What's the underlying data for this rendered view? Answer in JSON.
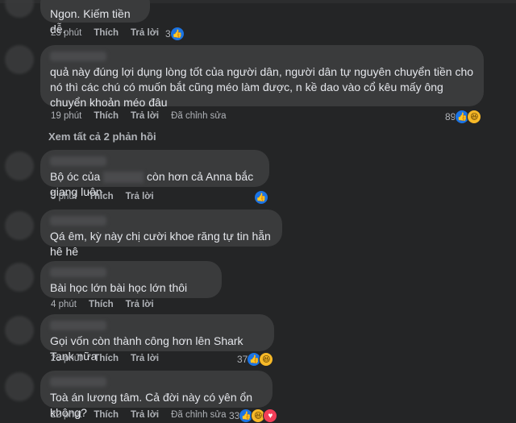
{
  "comments": [
    {
      "text": "Ngon. Kiếm tiền dễ.",
      "time": "23 phút",
      "like": "Thích",
      "reply": "Trả lời",
      "reaction_count": "3"
    },
    {
      "text": "quả này đúng lợi dụng lòng tốt của người dân, người dân tự nguyên chuyển tiền cho nó thì các chú có muốn bắt cũng méo làm được, n kề dao vào cổ kêu mấy ông chuyển khoản méo đâu",
      "time": "19 phút",
      "like": "Thích",
      "reply": "Trả lời",
      "edited": "Đã chỉnh sửa",
      "reaction_count": "89"
    },
    {
      "text_pre": "Bộ óc của",
      "text_post": "còn hơn cả Anna bắc giang luôn.",
      "time": "5 phút",
      "like": "Thích",
      "reply": "Trả lời"
    },
    {
      "text": "Qá êm, kỳ này chị cười khoe răng tự tin hẵn hê hê"
    },
    {
      "text": "Bài học lớn bài học lớn thôi",
      "time": "4 phút",
      "like": "Thích",
      "reply": "Trả lời"
    },
    {
      "text": "Gọi vốn còn thành công hơn lên Shark Tank nữa",
      "time": "23 phút",
      "like": "Thích",
      "reply": "Trả lời",
      "reaction_count": "37"
    },
    {
      "text": "Toà án lương tâm. Cả đời này có yên ổn không?",
      "time": "22 phút",
      "like": "Thích",
      "reply": "Trả lời",
      "edited": "Đã chỉnh sửa",
      "reaction_count": "33"
    }
  ],
  "view_more": "Xem tất cả 2 phản hồi",
  "icons": {
    "like": "like-icon",
    "haha": "haha-icon",
    "love": "love-icon"
  },
  "colors": {
    "background": "#242526",
    "bubble": "#3a3b3c",
    "like_blue": "#1b74e4",
    "haha_yellow": "#f7b928",
    "love_red": "#f33e58"
  }
}
